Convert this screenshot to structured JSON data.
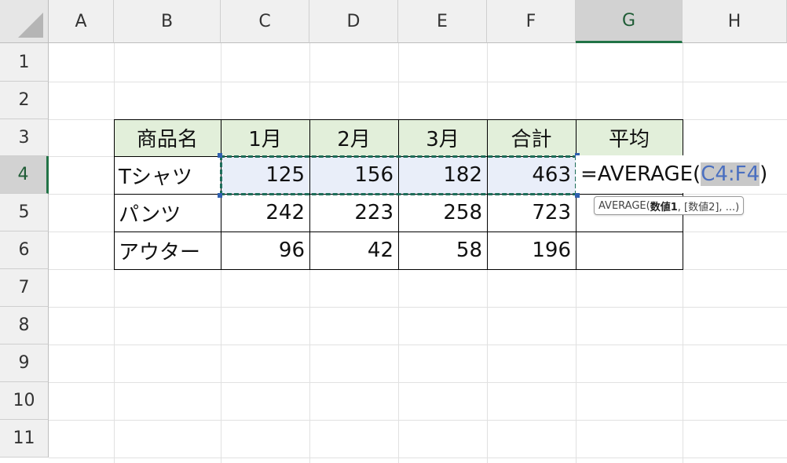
{
  "columns": [
    "A",
    "B",
    "C",
    "D",
    "E",
    "F",
    "G",
    "H"
  ],
  "rows": [
    "1",
    "2",
    "3",
    "4",
    "5",
    "6",
    "7",
    "8",
    "9",
    "10",
    "11"
  ],
  "selected_column": "G",
  "selected_row": "4",
  "table": {
    "headers": [
      "商品名",
      "1月",
      "2月",
      "3月",
      "合計",
      "平均"
    ],
    "rows": [
      {
        "name": "Tシャツ",
        "values": [
          "125",
          "156",
          "182",
          "463"
        ]
      },
      {
        "name": "パンツ",
        "values": [
          "242",
          "223",
          "258",
          "723"
        ]
      },
      {
        "name": "アウター",
        "values": [
          "96",
          "42",
          "58",
          "196"
        ]
      }
    ]
  },
  "formula": {
    "prefix": "=AVERAGE(",
    "reference": "C4:F4",
    "suffix": ")"
  },
  "tooltip": {
    "func": "AVERAGE(",
    "arg1": "数値1",
    "rest": ", [数値2], ...)"
  },
  "colors": {
    "accent": "#217346",
    "header_fill": "#e2efda",
    "range_fill": "#e9eef9",
    "reference_text": "#4a6fc0"
  }
}
